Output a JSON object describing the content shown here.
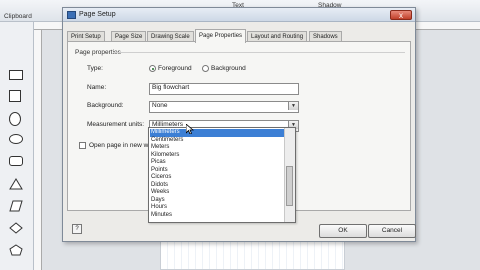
{
  "ribbon": {
    "clipboard": "Clipboard",
    "text": "Text",
    "shadow": "Shadow"
  },
  "dialog": {
    "title": "Page Setup",
    "close_glyph": "x",
    "tabs": [
      "Print Setup",
      "Page Size",
      "Drawing Scale",
      "Page Properties",
      "Layout and Routing",
      "Shadows"
    ],
    "group_label": "Page properties",
    "type_label": "Type:",
    "type_options": [
      "Foreground",
      "Background"
    ],
    "name_label": "Name:",
    "name_value": "Big flowchart",
    "background_label": "Background:",
    "background_value": "None",
    "units_label": "Measurement units:",
    "units_value": "Millimeters",
    "unit_options": [
      "Millimeters",
      "Centimeters",
      "Meters",
      "Kilometers",
      "Picas",
      "Points",
      "Ciceros",
      "Didots",
      "Weeks",
      "Days",
      "Hours",
      "Minutes"
    ],
    "open_page_label": "Open page in new w",
    "ok": "OK",
    "cancel": "Cancel"
  }
}
